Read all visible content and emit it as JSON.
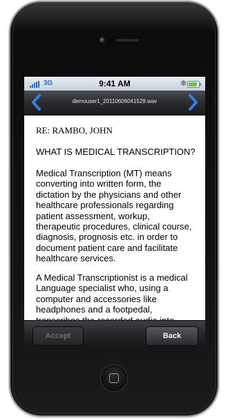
{
  "status_bar": {
    "carrier": "3G",
    "time": "9:41 AM",
    "bluetooth_icon": "bluetooth-icon",
    "battery_level": 0.85
  },
  "nav_bar": {
    "title": "demouser1_20110606041529.wav",
    "prev_icon": "chevron-left-icon",
    "next_icon": "chevron-right-icon"
  },
  "document": {
    "re_line": "RE: RAMBO, JOHN",
    "heading": "WHAT IS MEDICAL TRANSCRIPTION?",
    "paragraph1": "Medical Transcription (MT) means converting into written form, the dictation by the physicians and other healthcare professionals regarding patient assessment, workup, therapeutic procedures, clinical course, diagnosis, prognosis etc. in order to document patient care and facilitate healthcare services.",
    "paragraph2": "A Medical Transcriptionist is a medical Language specialist who, using a computer and accessories like headphones and a footpedal, transcribes the recorded audio into"
  },
  "toolbar": {
    "accept_label": "Accept",
    "back_label": "Back"
  },
  "colors": {
    "carrier": "#2a6ad8",
    "nav_arrows": "#2f7fe8",
    "battery_fill": "#5fc84a"
  }
}
